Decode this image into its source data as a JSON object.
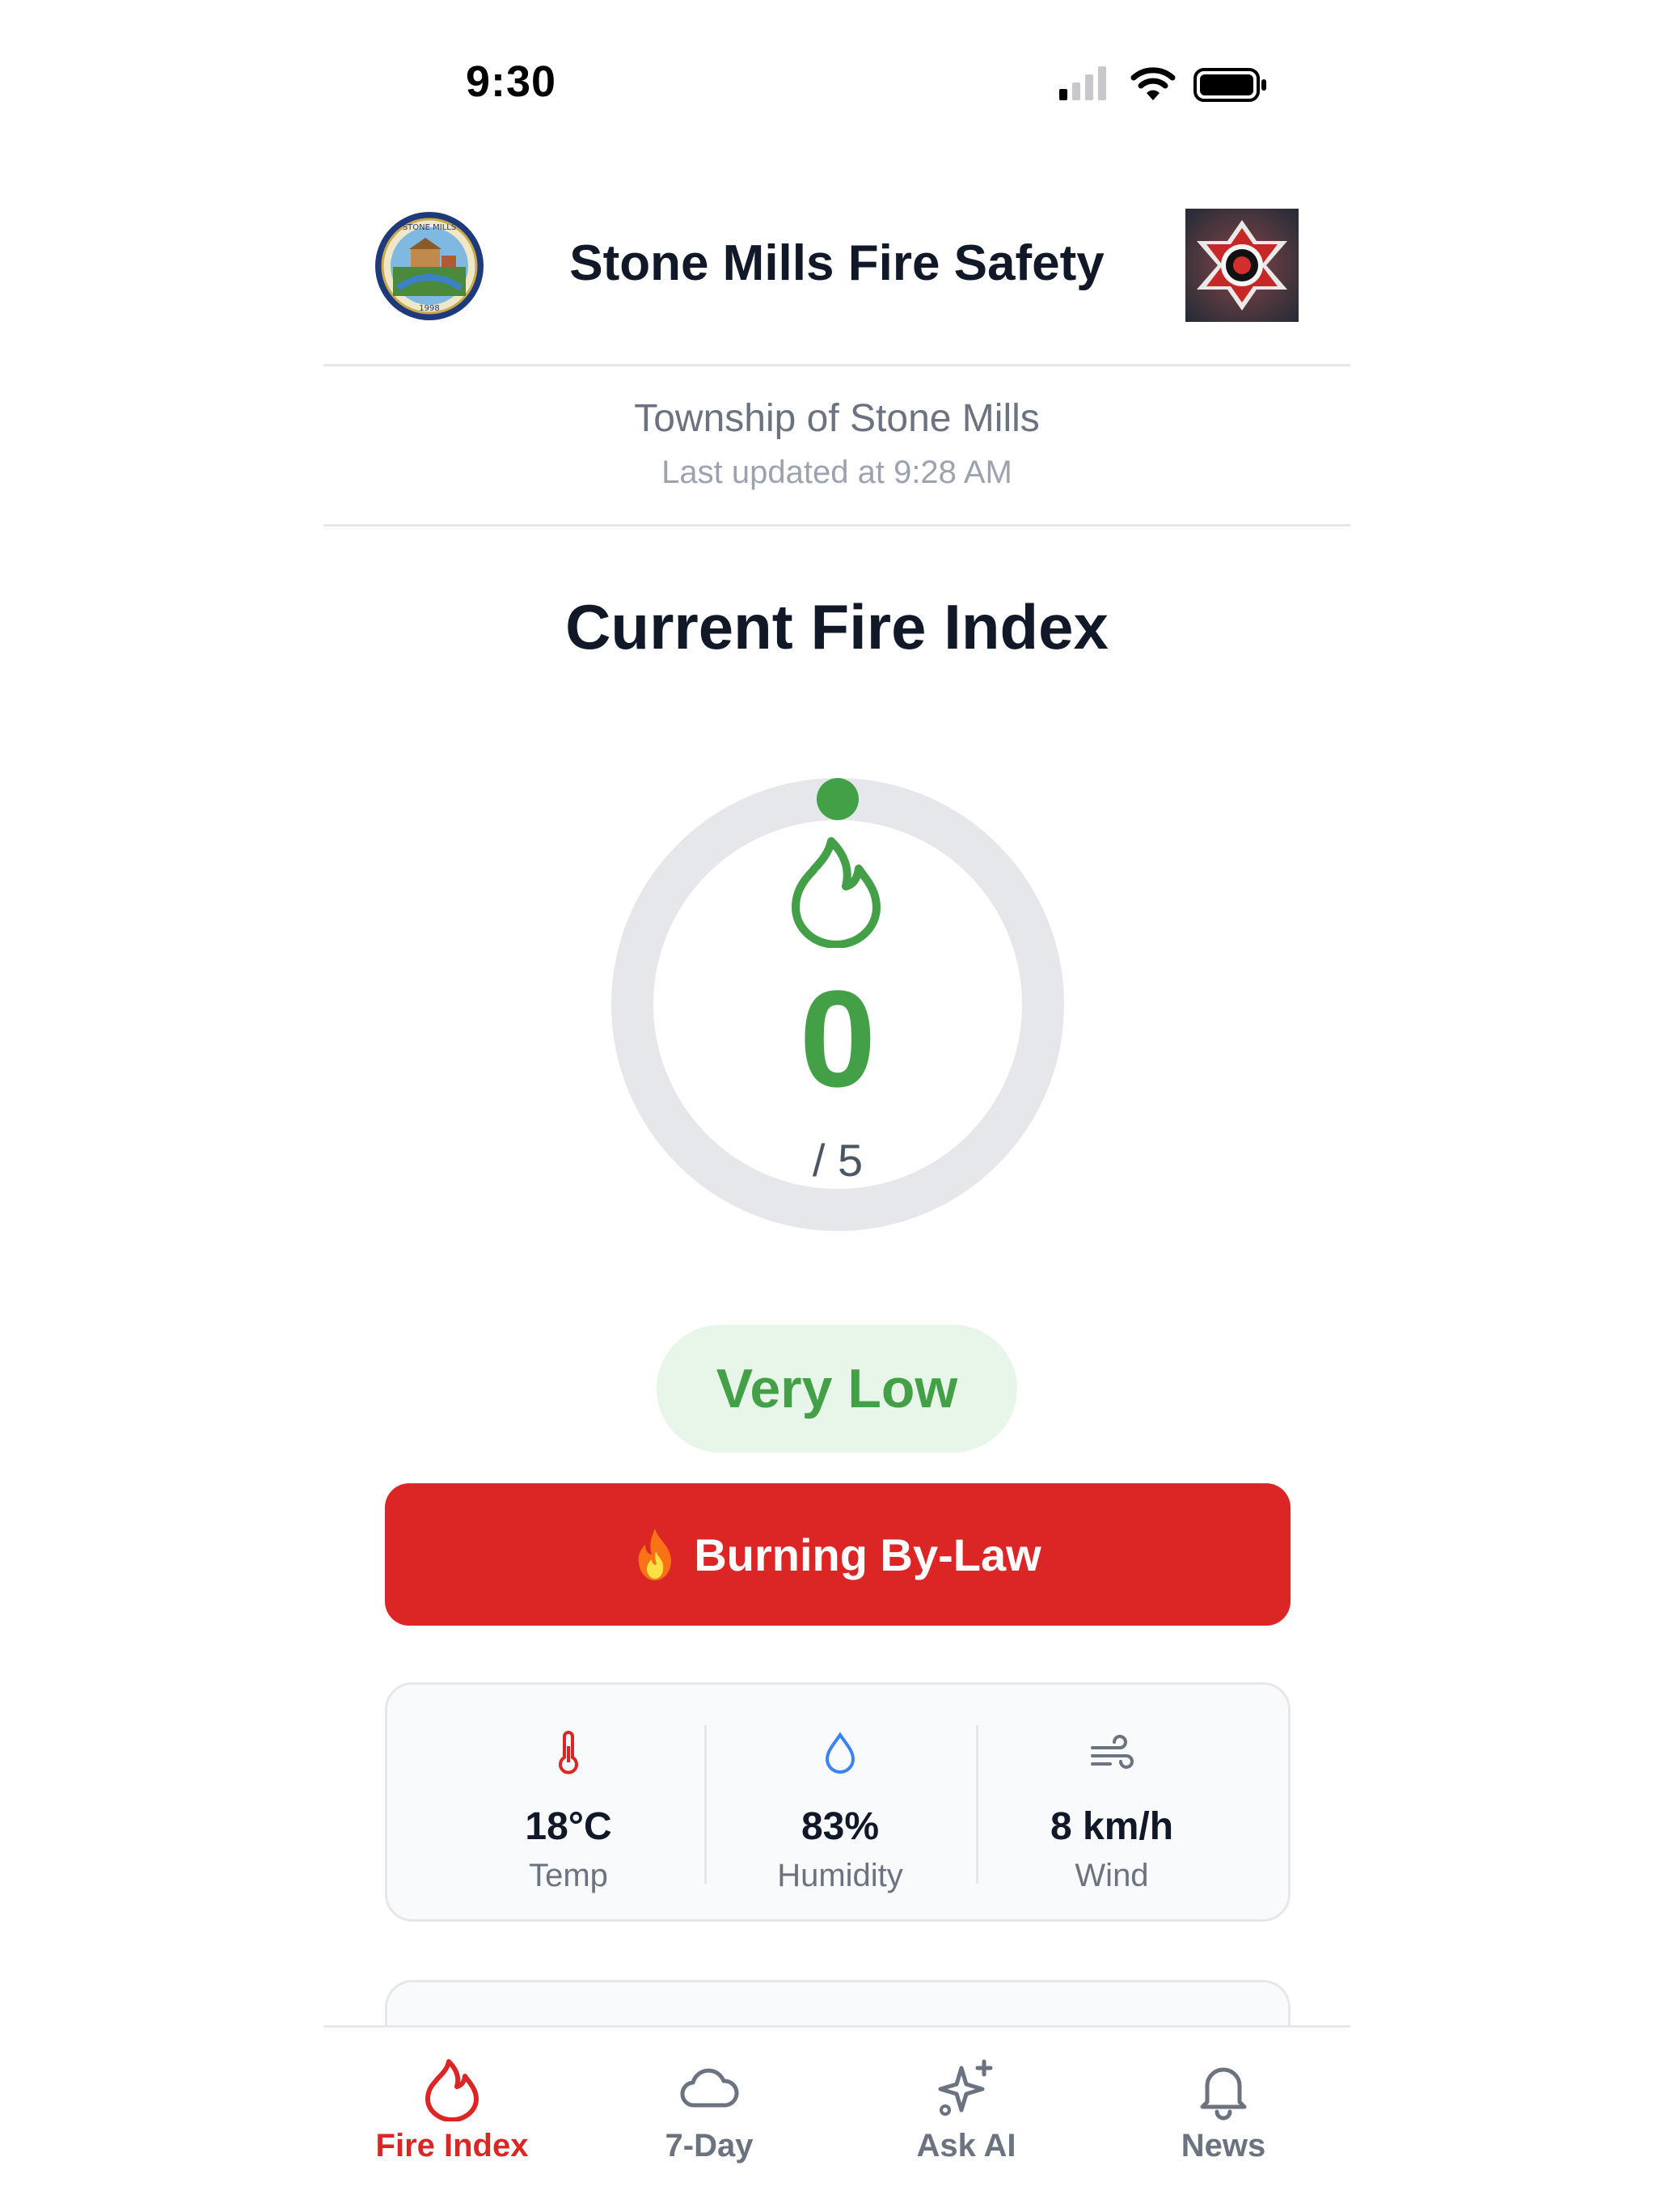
{
  "status_bar": {
    "time": "9:30"
  },
  "header": {
    "title": "Stone Mills Fire Safety",
    "left_logo": "township-seal-logo",
    "right_logo": "fire-department-logo",
    "left_logo_text": "TOWNSHIP OF STONE MILLS 1998"
  },
  "location": {
    "name": "Township of Stone Mills",
    "updated": "Last updated at 9:28 AM"
  },
  "fire_index": {
    "section_title": "Current Fire Index",
    "value": "0",
    "max": "/ 5",
    "level": "Very Low",
    "color": "#43a047",
    "track_color": "#e5e7eb"
  },
  "bylaw_button": {
    "label": "Burning By-Law",
    "color": "#dc2626"
  },
  "weather": [
    {
      "icon": "thermometer-icon",
      "value": "18°C",
      "label": "Temp"
    },
    {
      "icon": "droplet-icon",
      "value": "83%",
      "label": "Humidity"
    },
    {
      "icon": "wind-icon",
      "value": "8 km/h",
      "label": "Wind"
    }
  ],
  "tabs": [
    {
      "icon": "flame-icon",
      "label": "Fire Index",
      "active": true
    },
    {
      "icon": "cloud-icon",
      "label": "7-Day",
      "active": false
    },
    {
      "icon": "sparkles-icon",
      "label": "Ask AI",
      "active": false
    },
    {
      "icon": "bell-icon",
      "label": "News",
      "active": false
    }
  ],
  "accent_color": "#dc2626"
}
